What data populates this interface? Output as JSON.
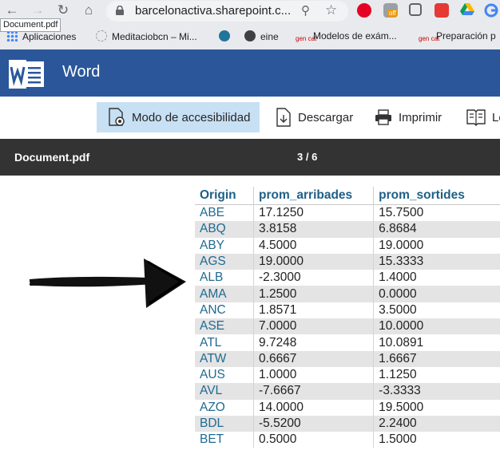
{
  "browser": {
    "url": "barcelonactiva.sharepoint.c...",
    "tab_tooltip": "Document.pdf",
    "ext_badge": "off",
    "bookmarks": [
      "Aplicaciones",
      "Meditaciobcn – Mi...",
      "eine",
      "Modelos de exám...",
      "Preparación p"
    ]
  },
  "app": {
    "name": "Word"
  },
  "toolbar": {
    "accessibility": "Modo de accesibilidad",
    "download": "Descargar",
    "print": "Imprimir",
    "read": "Le"
  },
  "doc": {
    "name": "Document.pdf",
    "pages": "3 / 6"
  },
  "table": {
    "headers": [
      "Origin",
      "prom_arribades",
      "prom_sortides"
    ],
    "rows": [
      [
        "ABE",
        "17.1250",
        "15.7500"
      ],
      [
        "ABQ",
        "3.8158",
        "6.8684"
      ],
      [
        "ABY",
        "4.5000",
        "19.0000"
      ],
      [
        "AGS",
        "19.0000",
        "15.3333"
      ],
      [
        "ALB",
        "-2.3000",
        "1.4000"
      ],
      [
        "AMA",
        "1.2500",
        "0.0000"
      ],
      [
        "ANC",
        "1.8571",
        "3.5000"
      ],
      [
        "ASE",
        "7.0000",
        "10.0000"
      ],
      [
        "ATL",
        "9.7248",
        "10.0891"
      ],
      [
        "ATW",
        "0.6667",
        "1.6667"
      ],
      [
        "AUS",
        "1.0000",
        "1.1250"
      ],
      [
        "AVL",
        "-7.6667",
        "-3.3333"
      ],
      [
        "AZO",
        "14.0000",
        "19.5000"
      ],
      [
        "BDL",
        "-5.5200",
        "2.2400"
      ],
      [
        "BET",
        "0.5000",
        "1.5000"
      ]
    ]
  },
  "colors": {
    "word_blue": "#2b579a",
    "active_btn": "#c7e0f4",
    "docbar": "#333333"
  }
}
